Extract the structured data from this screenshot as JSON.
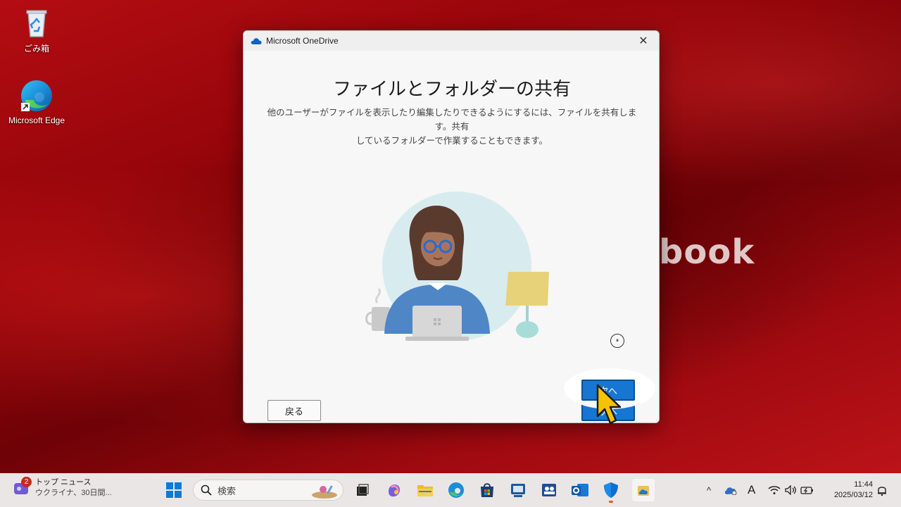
{
  "desktop": {
    "icons": [
      {
        "label": "ごみ箱",
        "icon": "recycle-bin-icon"
      },
      {
        "label": "Microsoft Edge",
        "icon": "edge-icon"
      }
    ],
    "wallpaper_text": "book"
  },
  "dialog": {
    "title": "Microsoft OneDrive",
    "close_glyph": "✕",
    "heading": "ファイルとフォルダーの共有",
    "description_line1": "他のユーザーがファイルを表示したり編集したりできるようにするには、ファイルを共有します。共有",
    "description_line2": "しているフォルダーで作業することもできます。",
    "pause_glyph": "⏸",
    "back_label": "戻る",
    "next_label": "次へ"
  },
  "taskbar": {
    "news_badge": "2",
    "news_title": "トップ ニュース",
    "news_sub": "ウクライナ、30日間...",
    "search_placeholder": "検索",
    "pinned": [
      "windows-start-icon",
      "task-view-icon",
      "copilot-icon",
      "file-explorer-icon",
      "edge-icon",
      "store-icon",
      "monitor-app-icon",
      "teams-icon",
      "outlook-icon",
      "security-shield-icon",
      "onedrive-setup-icon"
    ],
    "tray": {
      "chevron": "^",
      "ime": "A"
    },
    "clock_time": "11:44",
    "clock_date": "2025/03/12"
  },
  "colors": {
    "accent": "#1676d2",
    "taskbar": "#eae6e6",
    "wallpaper": "#8e0308",
    "cursor": "#f5c400"
  }
}
